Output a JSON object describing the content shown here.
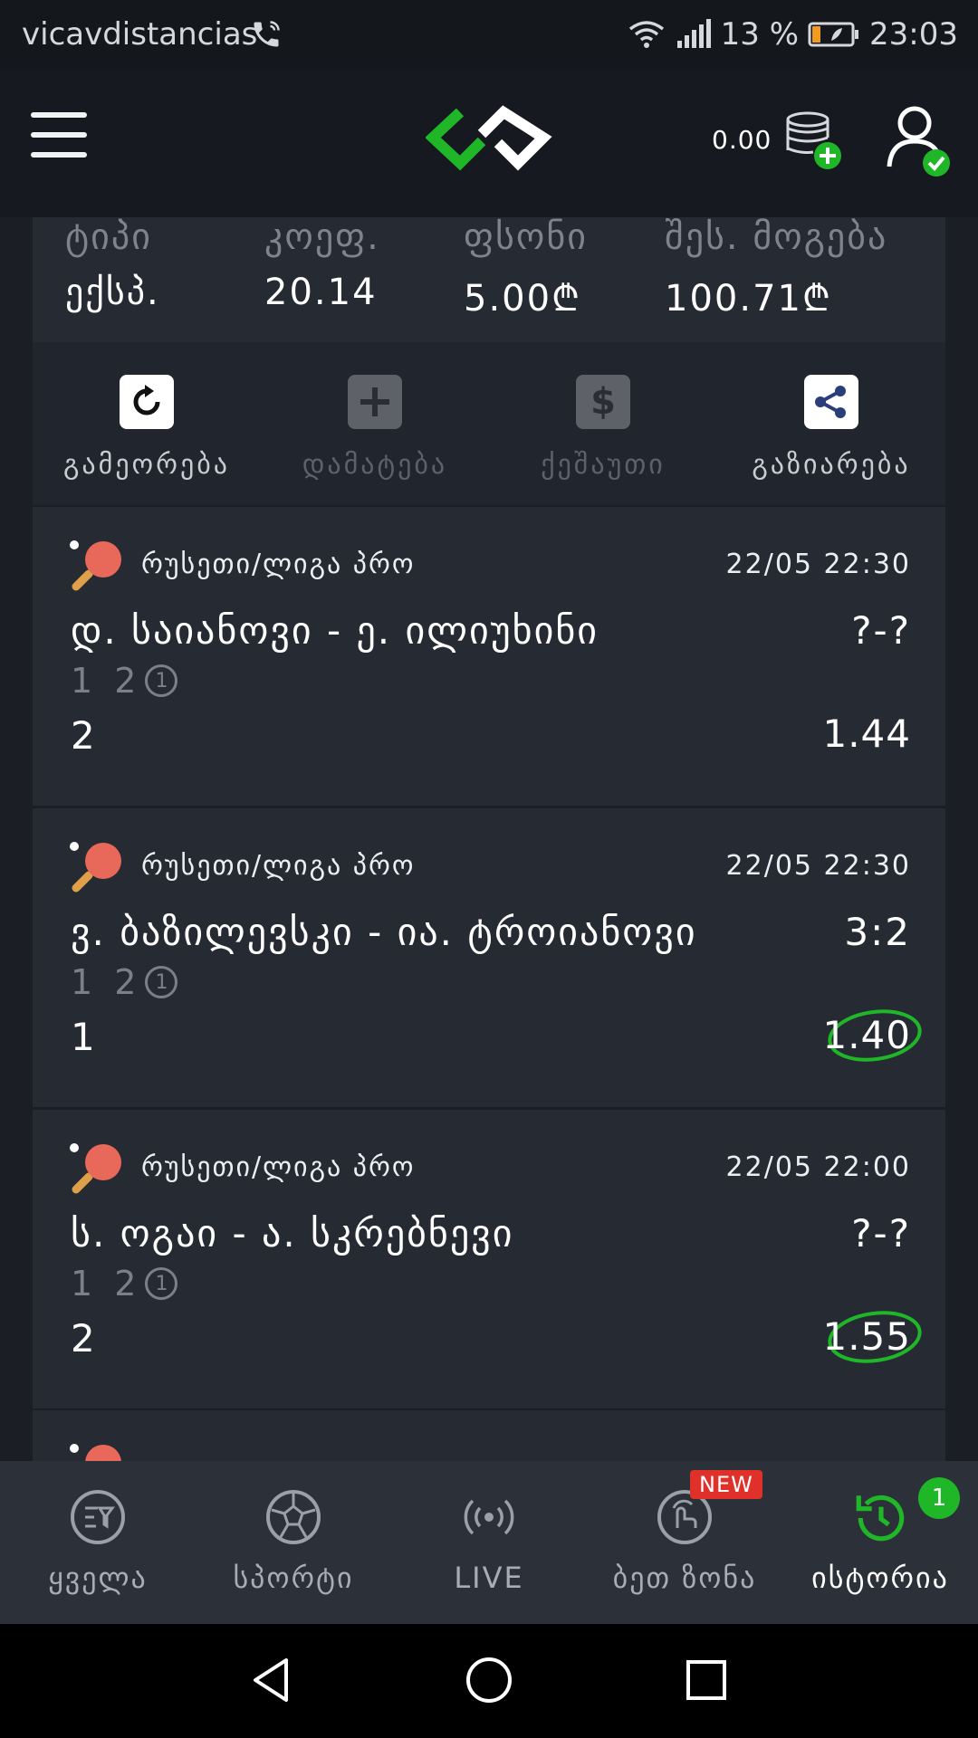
{
  "status_bar": {
    "carrier": "vicavdistancias",
    "battery": "13 %",
    "time": "23:03"
  },
  "header": {
    "balance": "0.00"
  },
  "summary": {
    "columns": [
      {
        "label": "ტიპი",
        "value": "ექსპ."
      },
      {
        "label": "კოეფ.",
        "value": "20.14"
      },
      {
        "label": "ფსონი",
        "value": "5.00₾"
      },
      {
        "label": "შეს. მოგება",
        "value": "100.71₾"
      }
    ]
  },
  "actions": [
    {
      "label": "გამეორება",
      "icon": "repeat-icon",
      "enabled": true
    },
    {
      "label": "დამატება",
      "icon": "plus-icon",
      "enabled": false
    },
    {
      "label": "ქეშაუთი",
      "icon": "dollar-icon",
      "enabled": false
    },
    {
      "label": "გაზიარება",
      "icon": "share-icon",
      "enabled": true
    }
  ],
  "events": [
    {
      "league": "რუსეთი/ლიგა პრო",
      "date": "22/05 22:30",
      "teams": "დ. საიანოვი - ე. ილიუხინი",
      "score": "?-?",
      "markets": "1 2",
      "market_badge": "1",
      "pick": "2",
      "odds": "1.44",
      "circled": false
    },
    {
      "league": "რუსეთი/ლიგა პრო",
      "date": "22/05 22:30",
      "teams": "ვ. ბაზილევსკი - ია. ტროიანოვი",
      "score": "3:2",
      "markets": "1 2",
      "market_badge": "1",
      "pick": "1",
      "odds": "1.40",
      "circled": true
    },
    {
      "league": "რუსეთი/ლიგა პრო",
      "date": "22/05 22:00",
      "teams": "ს. ოგაი - ა. სკრებნევი",
      "score": "?-?",
      "markets": "1 2",
      "market_badge": "1",
      "pick": "2",
      "odds": "1.55",
      "circled": true
    }
  ],
  "bottom_nav": {
    "items": [
      {
        "label": "ყველა",
        "icon": "all-filter-icon"
      },
      {
        "label": "სპორტი",
        "icon": "soccer-ball-icon"
      },
      {
        "label": "LIVE",
        "icon": "live-broadcast-icon"
      },
      {
        "label": "ბეთ ზონა",
        "icon": "bet-zone-icon"
      },
      {
        "label": "ისტორია",
        "icon": "history-icon"
      }
    ],
    "new_badge": "NEW",
    "history_count": "1"
  },
  "colors": {
    "accent_green": "#1fb628",
    "badge_red": "#e0302a"
  }
}
